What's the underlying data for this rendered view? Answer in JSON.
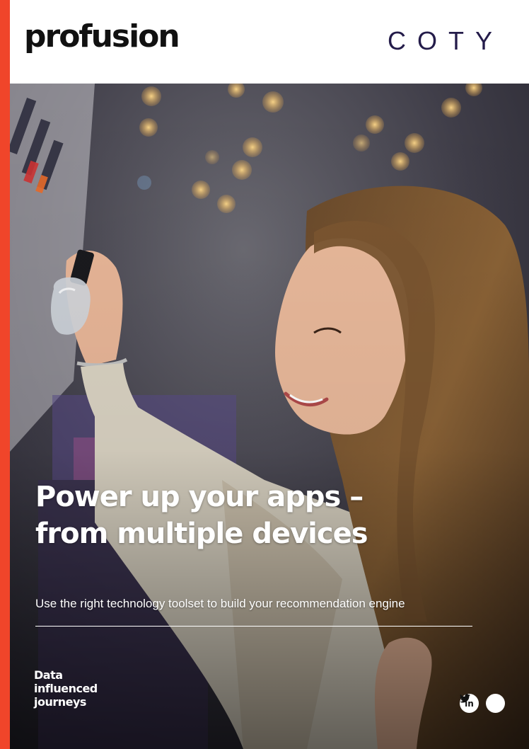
{
  "header": {
    "brand_left": "profusion",
    "brand_right": "COTY"
  },
  "hero": {
    "headline_line1": "Power up your apps –",
    "headline_line2": "from multiple devices",
    "subheadline": "Use the right technology toolset to build your recommendation engine"
  },
  "footer": {
    "tagline": [
      "Data",
      "influenced",
      "journeys"
    ],
    "social": [
      {
        "icon": "linkedin-icon",
        "glyph": "in"
      },
      {
        "icon": "twitter-icon",
        "glyph": "•"
      }
    ]
  },
  "colors": {
    "accent": "#f0452a",
    "coty_navy": "#241c4a"
  }
}
